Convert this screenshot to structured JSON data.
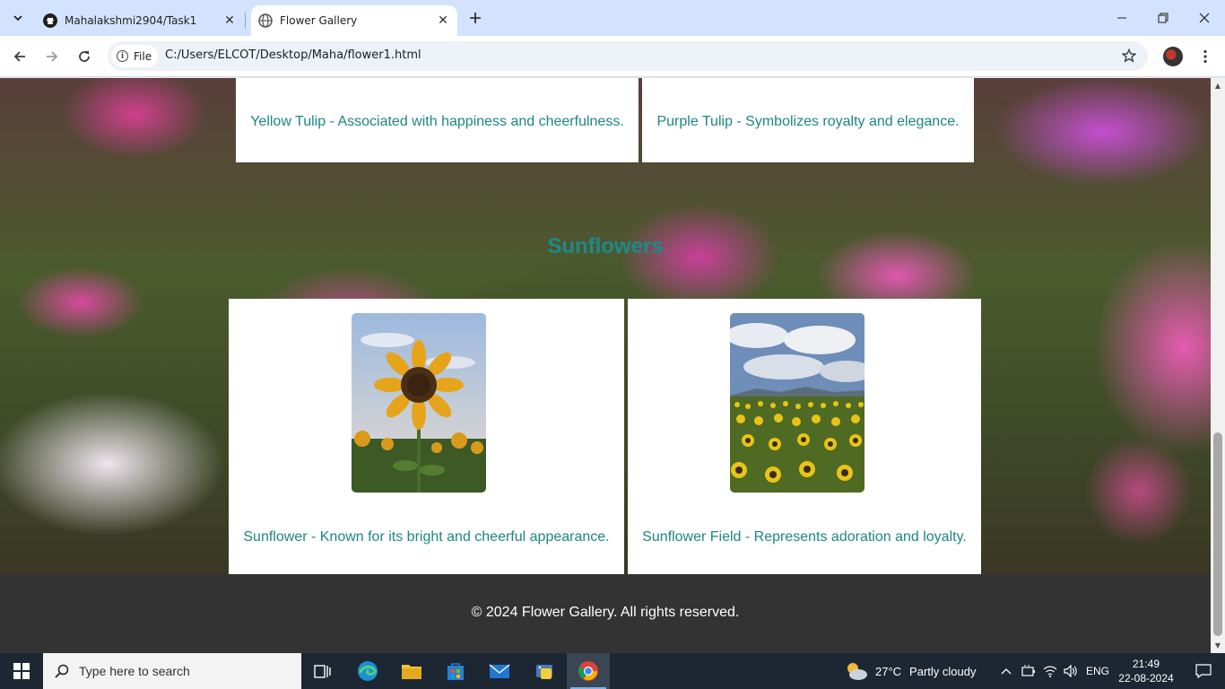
{
  "browser": {
    "tabs": [
      {
        "title": "Mahalakshmi2904/Task1",
        "active": false,
        "icon": "github-icon"
      },
      {
        "title": "Flower Gallery",
        "active": true,
        "icon": "globe-icon"
      }
    ],
    "address_chip": "File",
    "url": "C:/Users/ELCOT/Desktop/Maha/flower1.html"
  },
  "page": {
    "top_cards": [
      {
        "caption": "Yellow Tulip - Associated with happiness and cheerfulness."
      },
      {
        "caption": "Purple Tulip - Symbolizes royalty and elegance."
      }
    ],
    "section_title": "Sunflowers",
    "sunflower_cards": [
      {
        "caption": "Sunflower - Known for its bright and cheerful appearance.",
        "image": "single-sunflower"
      },
      {
        "caption": "Sunflower Field - Represents adoration and loyalty.",
        "image": "sunflower-field"
      }
    ],
    "footer": "© 2024 Flower Gallery. All rights reserved."
  },
  "taskbar": {
    "search_placeholder": "Type here to search",
    "weather_temp": "27°C",
    "weather_desc": "Partly cloudy",
    "language": "ENG",
    "time": "21:49",
    "date": "22-08-2024"
  },
  "colors": {
    "caption_teal": "#1d8585",
    "footer_bg": "#333333",
    "tabstrip_bg": "#d3e3fd"
  }
}
